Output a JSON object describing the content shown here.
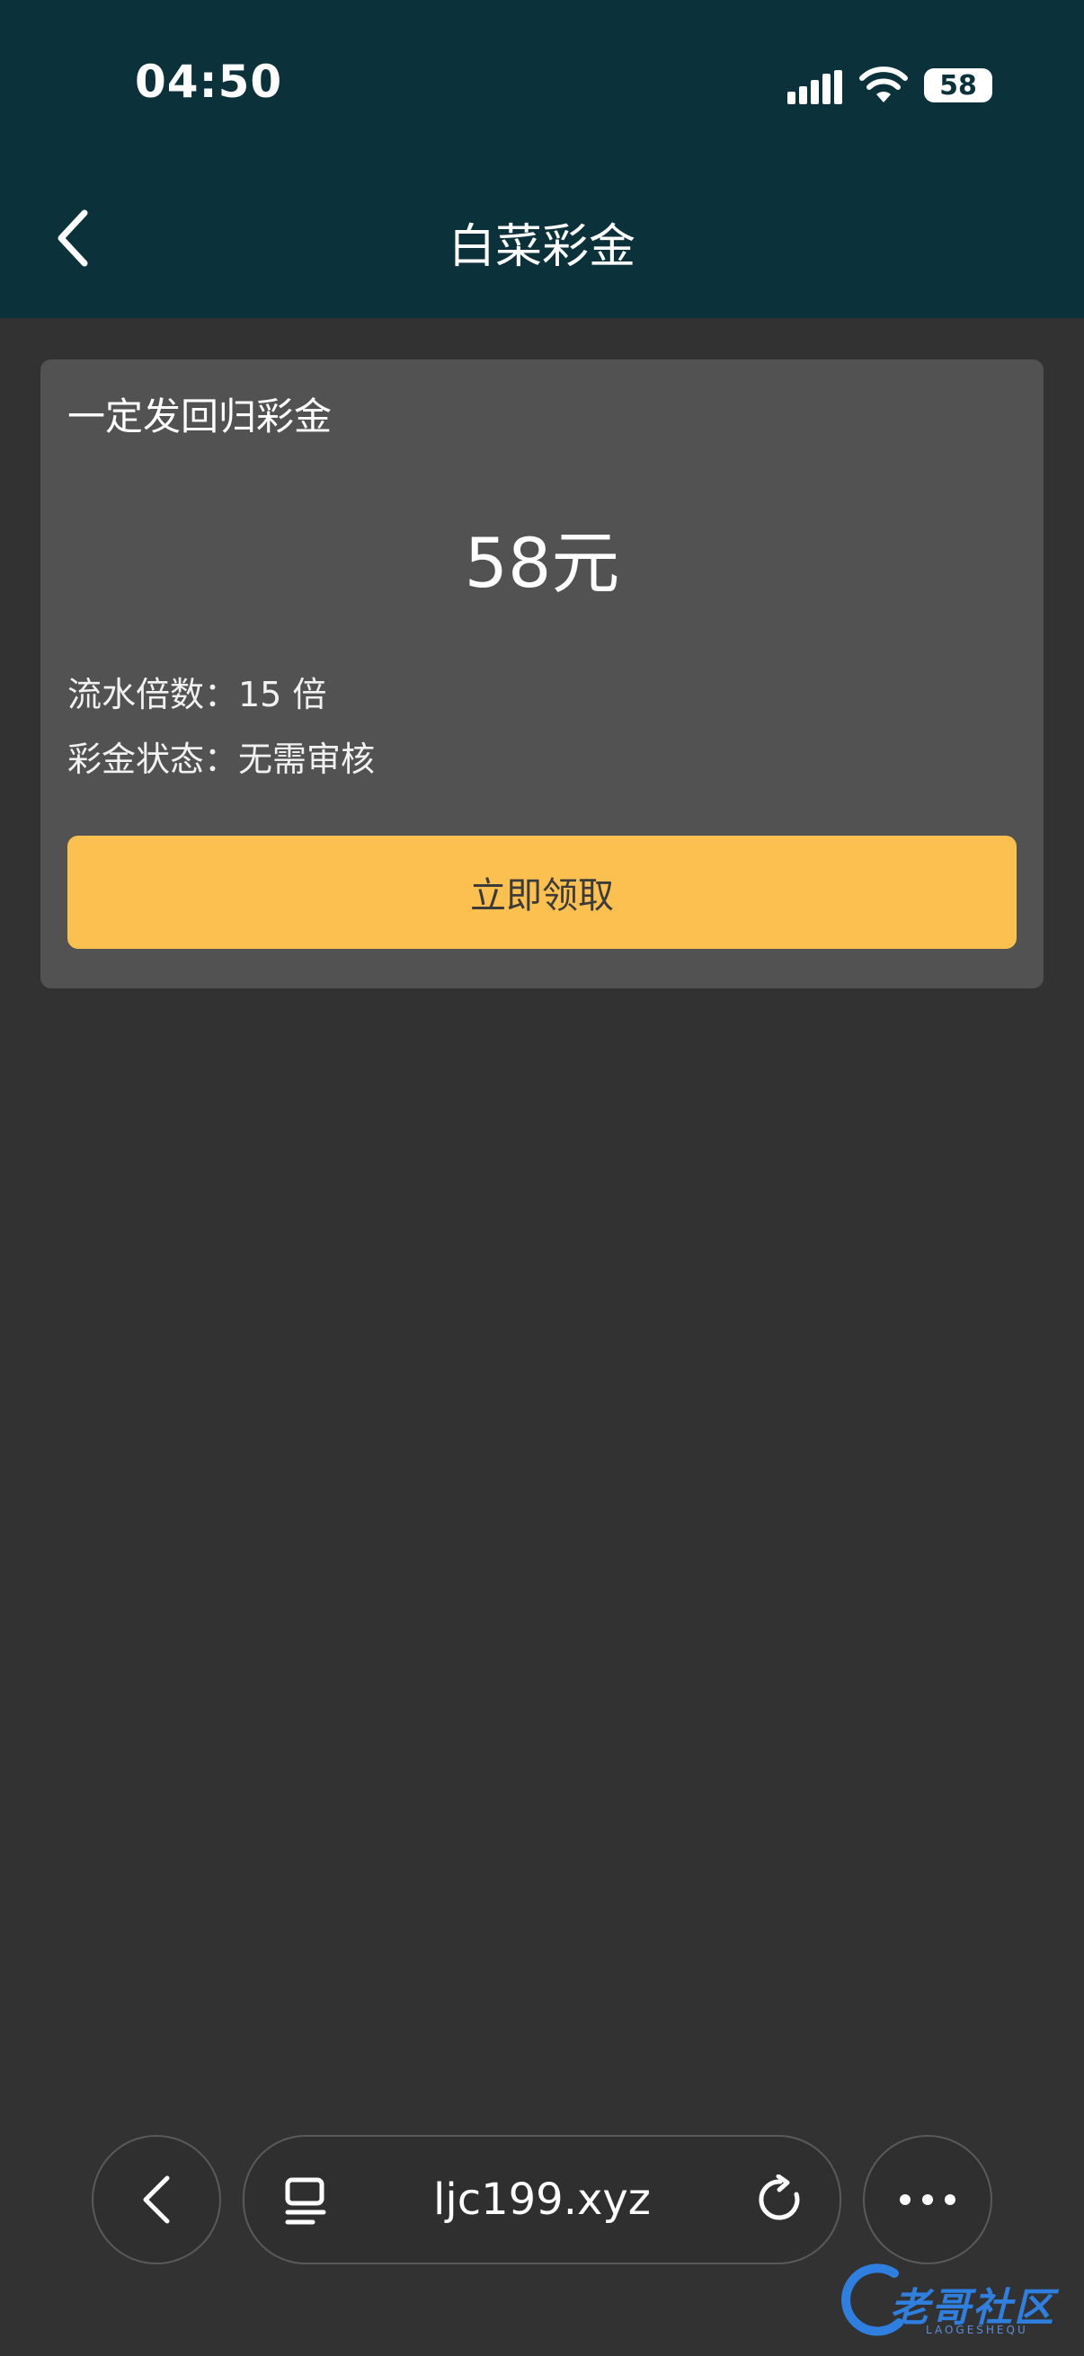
{
  "status_bar": {
    "time": "04:50",
    "battery": "58",
    "icons": [
      "signal-icon",
      "wifi-icon",
      "battery-icon"
    ]
  },
  "header": {
    "title": "白菜彩金",
    "back_icon": "chevron-left-icon"
  },
  "card": {
    "title": "一定发回归彩金",
    "amount": "58元",
    "turnover": "流水倍数：15 倍",
    "status": "彩金状态：无需审核",
    "button_label": "立即领取"
  },
  "browser": {
    "url": "ljc199.xyz",
    "icons": [
      "back-icon",
      "tabs-icon",
      "reload-icon",
      "more-icon"
    ]
  },
  "watermark": {
    "text": "老哥社区",
    "sub": "LAOGESHEQU"
  },
  "colors": {
    "header_bg": "#0b313b",
    "page_bg": "#323232",
    "card_bg": "#525252",
    "button_bg": "#fbc050"
  }
}
